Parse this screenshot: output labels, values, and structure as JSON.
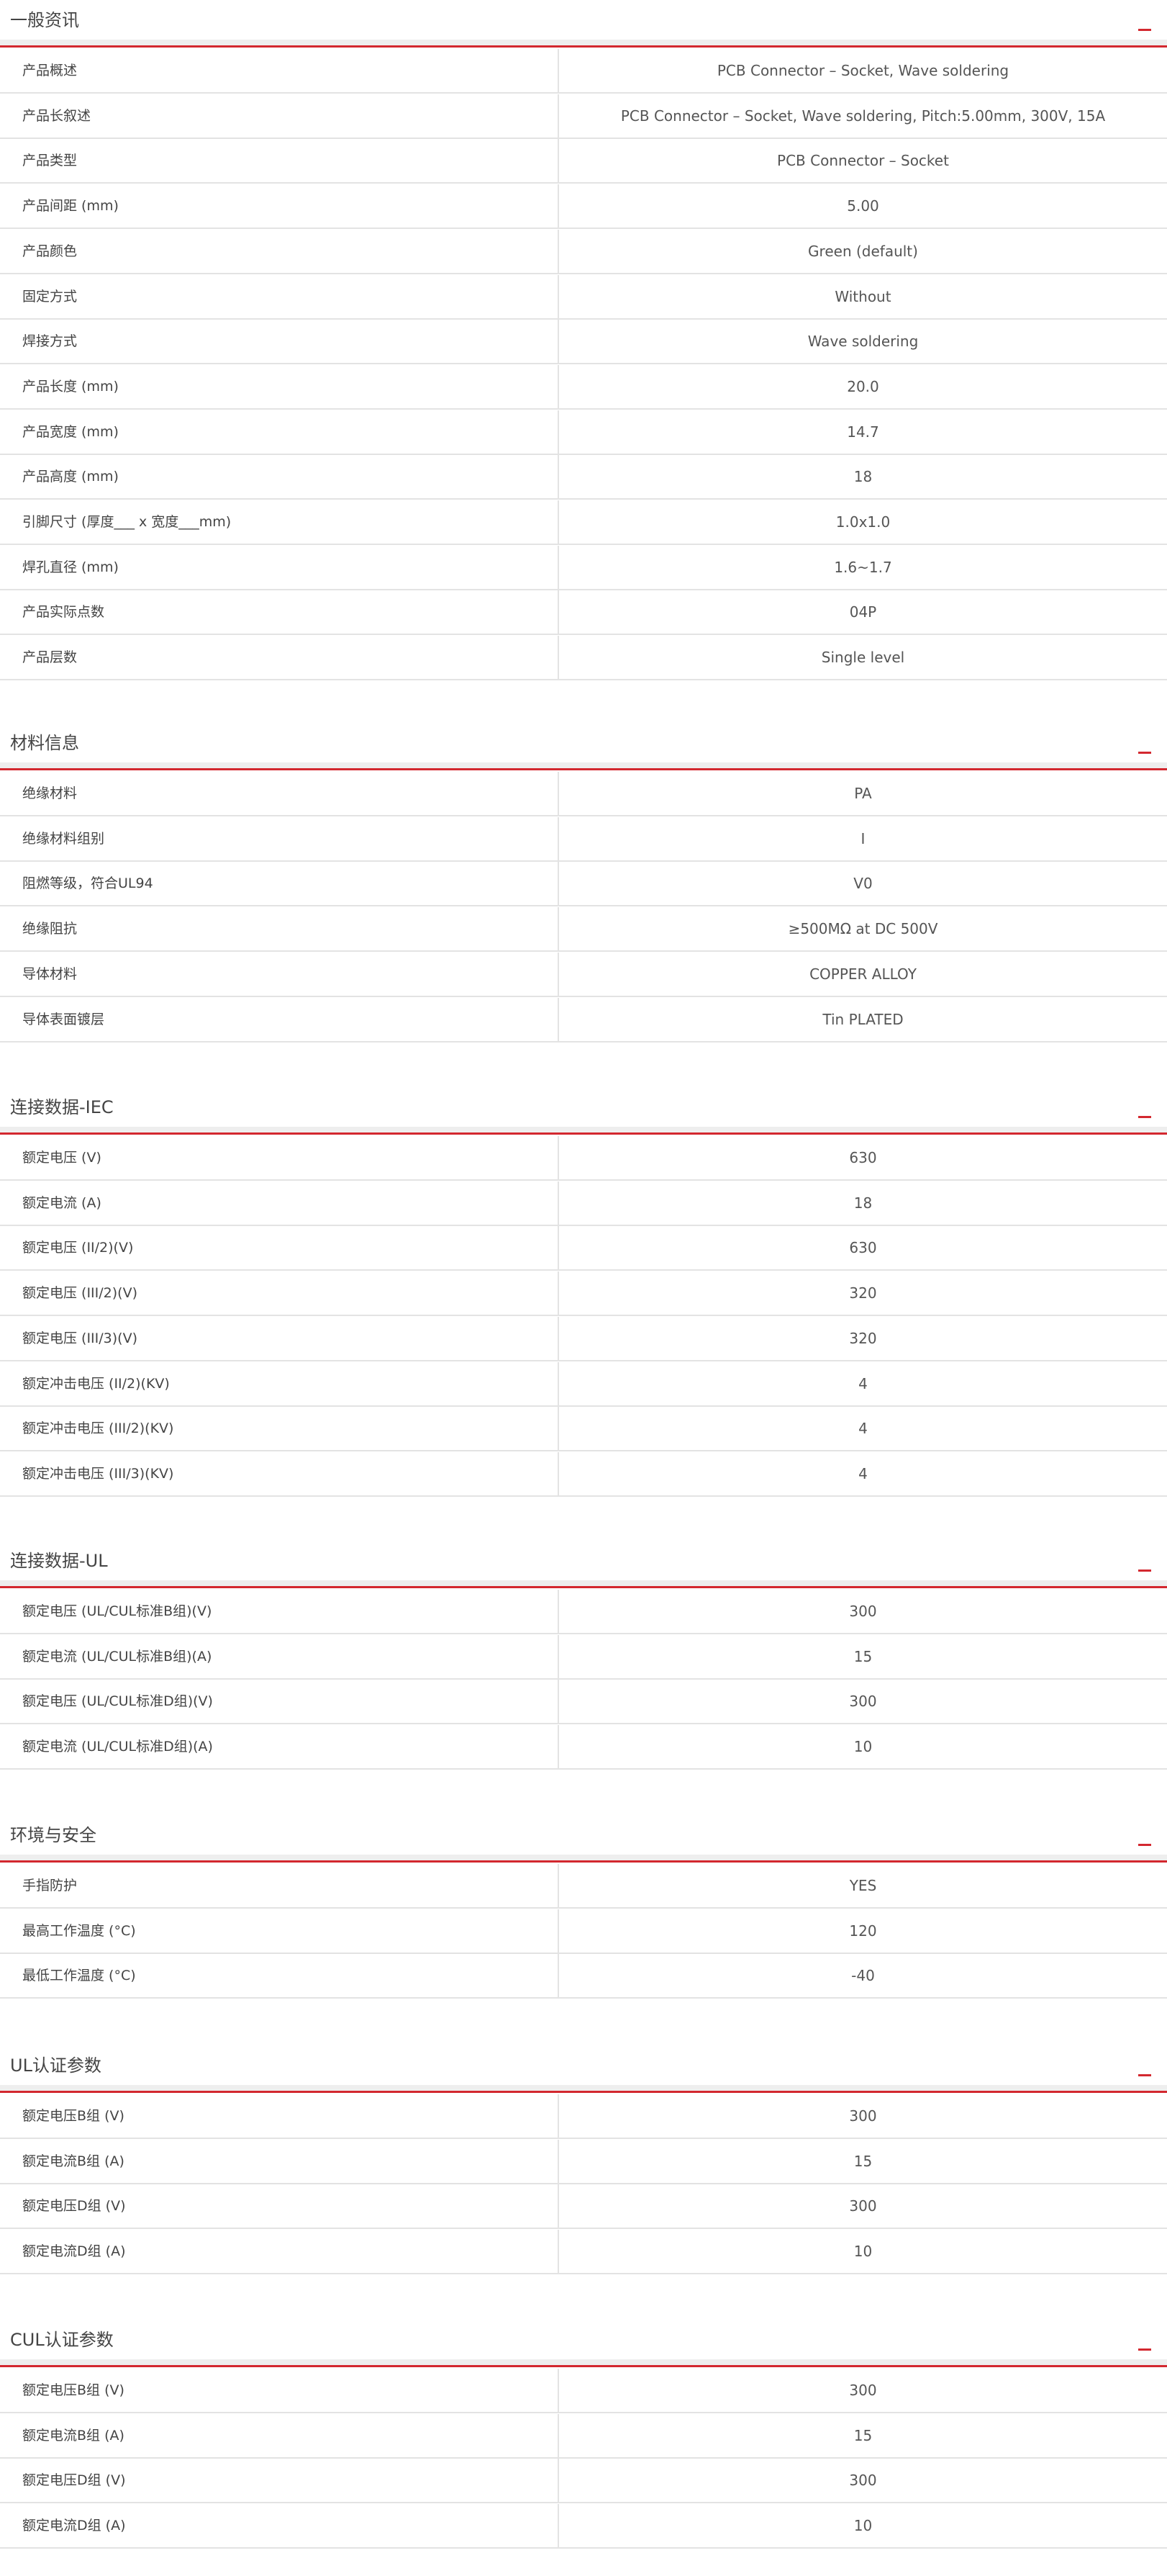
{
  "sections": [
    {
      "title": "一般资讯",
      "collapse_icon": "minus-icon",
      "rows": [
        {
          "label": "产品概述",
          "value": "PCB Connector – Socket, Wave soldering"
        },
        {
          "label": "产品长叙述",
          "value": "PCB Connector – Socket, Wave soldering, Pitch:5.00mm, 300V, 15A"
        },
        {
          "label": "产品类型",
          "value": "PCB Connector – Socket"
        },
        {
          "label": "产品间距 (mm)",
          "value": "5.00"
        },
        {
          "label": "产品颜色",
          "value": "Green (default)"
        },
        {
          "label": "固定方式",
          "value": "Without"
        },
        {
          "label": "焊接方式",
          "value": "Wave soldering"
        },
        {
          "label": "产品长度 (mm)",
          "value": "20.0"
        },
        {
          "label": "产品宽度 (mm)",
          "value": "14.7"
        },
        {
          "label": "产品高度 (mm)",
          "value": "18"
        },
        {
          "label": "引脚尺寸 (厚度___ x 宽度___mm)",
          "value": "1.0x1.0"
        },
        {
          "label": "焊孔直径 (mm)",
          "value": "1.6~1.7"
        },
        {
          "label": "产品实际点数",
          "value": "04P"
        },
        {
          "label": "产品层数",
          "value": "Single level"
        }
      ]
    },
    {
      "title": "材料信息",
      "collapse_icon": "minus-icon",
      "rows": [
        {
          "label": "绝缘材料",
          "value": "PA"
        },
        {
          "label": "绝缘材料组别",
          "value": "I"
        },
        {
          "label": "阻燃等级，符合UL94",
          "value": "V0"
        },
        {
          "label": "绝缘阻抗",
          "value": "≥500MΩ at DC 500V"
        },
        {
          "label": "导体材料",
          "value": "COPPER ALLOY"
        },
        {
          "label": "导体表面镀层",
          "value": "Tin PLATED"
        }
      ]
    },
    {
      "title": "连接数据-IEC",
      "collapse_icon": "minus-icon",
      "rows": [
        {
          "label": "额定电压 (V)",
          "value": "630"
        },
        {
          "label": "额定电流 (A)",
          "value": "18"
        },
        {
          "label": "额定电压 (II/2)(V)",
          "value": "630"
        },
        {
          "label": "额定电压 (III/2)(V)",
          "value": "320"
        },
        {
          "label": "额定电压 (III/3)(V)",
          "value": "320"
        },
        {
          "label": "额定冲击电压 (II/2)(KV)",
          "value": "4"
        },
        {
          "label": "额定冲击电压 (III/2)(KV)",
          "value": "4"
        },
        {
          "label": "额定冲击电压 (III/3)(KV)",
          "value": "4"
        }
      ]
    },
    {
      "title": "连接数据-UL",
      "collapse_icon": "minus-icon",
      "rows": [
        {
          "label": "额定电压 (UL/CUL标准B组)(V)",
          "value": "300"
        },
        {
          "label": "额定电流 (UL/CUL标准B组)(A)",
          "value": "15"
        },
        {
          "label": "额定电压 (UL/CUL标准D组)(V)",
          "value": "300"
        },
        {
          "label": "额定电流 (UL/CUL标准D组)(A)",
          "value": "10"
        }
      ]
    },
    {
      "title": "环境与安全",
      "collapse_icon": "minus-icon",
      "rows": [
        {
          "label": "手指防护",
          "value": "YES"
        },
        {
          "label": "最高工作温度 (°C)",
          "value": "120"
        },
        {
          "label": "最低工作温度 (°C)",
          "value": "-40"
        }
      ]
    },
    {
      "title": "UL认证参数",
      "collapse_icon": "minus-icon",
      "rows": [
        {
          "label": "额定电压B组 (V)",
          "value": "300"
        },
        {
          "label": "额定电流B组 (A)",
          "value": "15"
        },
        {
          "label": "额定电压D组 (V)",
          "value": "300"
        },
        {
          "label": "额定电流D组 (A)",
          "value": "10"
        }
      ]
    },
    {
      "title": "CUL认证参数",
      "collapse_icon": "minus-icon",
      "rows": [
        {
          "label": "额定电压B组 (V)",
          "value": "300"
        },
        {
          "label": "额定电流B组 (A)",
          "value": "15"
        },
        {
          "label": "额定电压D组 (V)",
          "value": "300"
        },
        {
          "label": "额定电流D组 (A)",
          "value": "10"
        }
      ]
    }
  ],
  "colors": {
    "accent": "#d3282f",
    "row_border": "#e3e3e3",
    "strip": "#eeeeee"
  }
}
